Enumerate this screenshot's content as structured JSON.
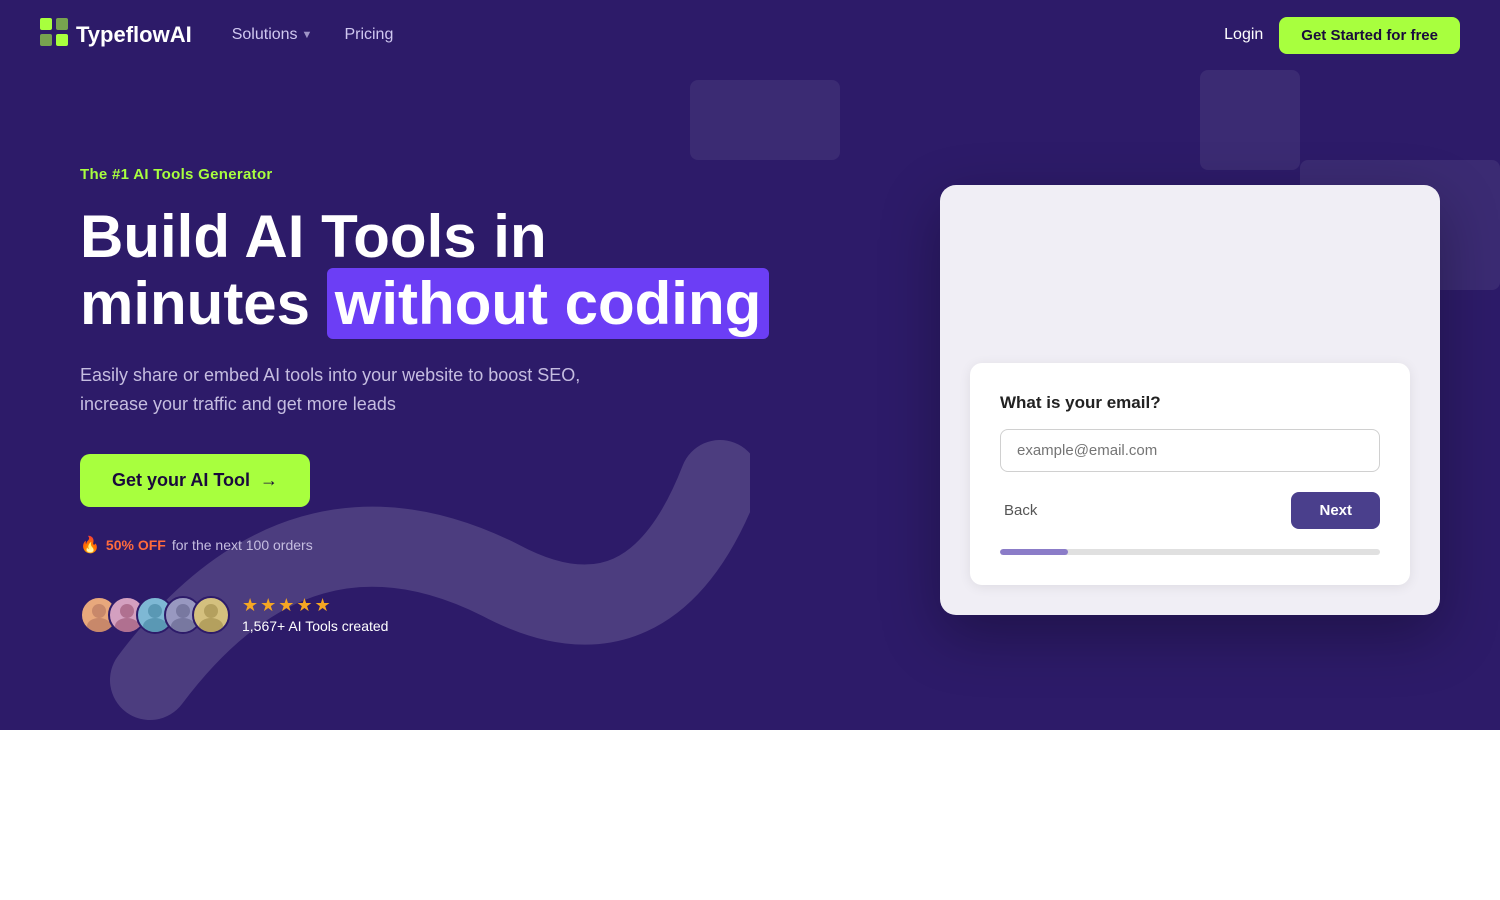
{
  "navbar": {
    "logo_text": "TypeflowAI",
    "logo_icon": "⬛",
    "nav_solutions_label": "Solutions",
    "nav_pricing_label": "Pricing",
    "login_label": "Login",
    "get_started_label": "Get Started for free"
  },
  "hero": {
    "tagline": "The #1 AI Tools Generator",
    "title_line1": "Build AI Tools in",
    "title_highlight": "without coding",
    "title_prefix": "minutes ",
    "description": "Easily share or embed AI tools into your website to boost SEO, increase your traffic and get more leads",
    "cta_label": "Get your AI Tool",
    "cta_arrow": "→",
    "offer_fire": "🔥",
    "offer_badge": "50% OFF",
    "offer_text": "for the next 100 orders",
    "stars": "★★★★★",
    "proof_count": "1,567+ AI Tools created"
  },
  "demo_card": {
    "question": "What is your email?",
    "email_placeholder": "example@email.com",
    "back_label": "Back",
    "next_label": "Next",
    "progress_percent": 18
  },
  "avatars": [
    {
      "bg": "#e8a87c",
      "initial": ""
    },
    {
      "bg": "#d4a0c0",
      "initial": ""
    },
    {
      "bg": "#7eb8d4",
      "initial": ""
    },
    {
      "bg": "#a8a8c8",
      "initial": ""
    },
    {
      "bg": "#d4c07e",
      "initial": ""
    }
  ]
}
